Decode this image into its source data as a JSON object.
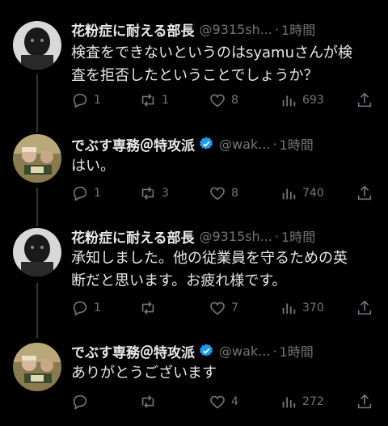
{
  "tweets": [
    {
      "name": "花粉症に耐える部長",
      "verified": false,
      "handle": "@9315sh...",
      "dot": "·",
      "time": "1時間",
      "text_lines": [
        "検査をできないというのはsyamuさんが検",
        "査を拒否したということでしょうか？"
      ],
      "reply_count": "1",
      "retweet_count": "1",
      "like_count": "8",
      "view_count": "693"
    },
    {
      "name": "でぶす専務＠特攻派",
      "verified": true,
      "handle": "@wak...",
      "dot": "·",
      "time": "1時間",
      "text_lines": [
        "はい。"
      ],
      "reply_count": "1",
      "retweet_count": "3",
      "like_count": "8",
      "view_count": "740"
    },
    {
      "name": "花粉症に耐える部長",
      "verified": false,
      "handle": "@9315sh...",
      "dot": "·",
      "time": "1時間",
      "text_lines": [
        "承知しました。他の従業員を守るための英",
        "断だと思います。お疲れ様です。"
      ],
      "reply_count": "1",
      "retweet_count": "",
      "like_count": "7",
      "view_count": "370"
    },
    {
      "name": "でぶす専務＠特攻派",
      "verified": true,
      "handle": "@wak...",
      "dot": "·",
      "time": "1時間",
      "text_lines": [
        "ありがとうございます"
      ],
      "reply_count": "",
      "retweet_count": "",
      "like_count": "4",
      "view_count": "272"
    }
  ],
  "icons": {
    "reply": "reply-icon",
    "retweet": "retweet-icon",
    "like": "heart-icon",
    "views": "views-icon",
    "share": "share-icon",
    "verified": "verified-badge-icon"
  },
  "colors": {
    "background": "#000000",
    "text": "#e7e9ea",
    "secondary": "#71767b",
    "verified": "#1d9bf0",
    "thread_line": "#333639"
  }
}
